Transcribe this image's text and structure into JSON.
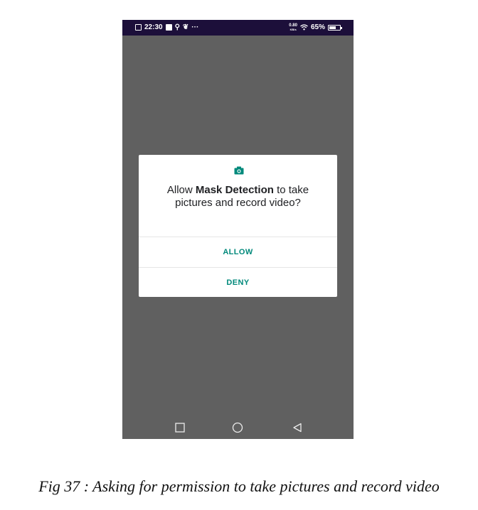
{
  "status_bar": {
    "time": "22:30",
    "icons_left": [
      "calendar-icon",
      "notification-icon",
      "usb-icon",
      "app-icon"
    ],
    "more": "···",
    "speed_value": "0.80",
    "speed_unit": "KB/s",
    "battery_percent": "65%",
    "battery_level": 0.65
  },
  "dialog": {
    "icon": "camera-icon",
    "message_prefix": "Allow ",
    "app_name": "Mask Detection",
    "message_suffix": " to take pictures and record video?",
    "allow_label": "ALLOW",
    "deny_label": "DENY",
    "accent_color": "#00897b"
  },
  "nav_bar": {
    "buttons": [
      "recent-apps-icon",
      "home-icon",
      "back-icon"
    ]
  },
  "caption": "Fig 37 : Asking for permission to take pictures and record video"
}
